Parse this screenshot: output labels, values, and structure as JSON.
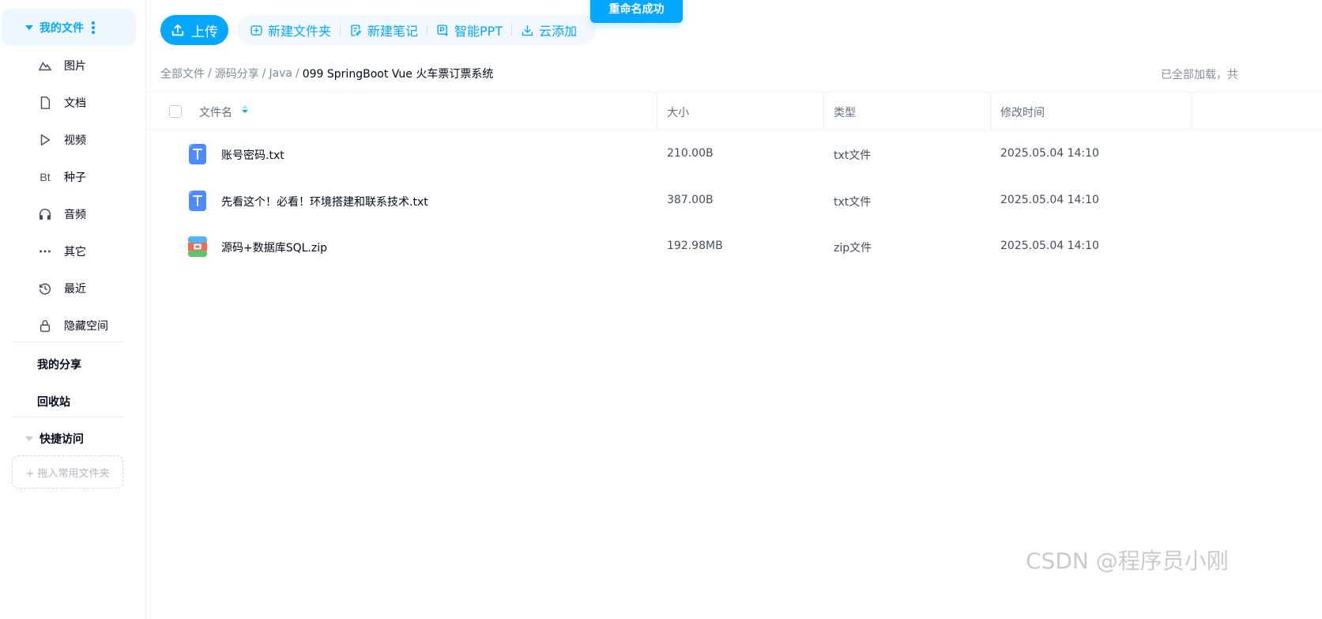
{
  "sidebar": {
    "header_label": "我的文件",
    "items": [
      {
        "label": "图片",
        "icon": "image-icon"
      },
      {
        "label": "文档",
        "icon": "document-icon"
      },
      {
        "label": "视频",
        "icon": "video-icon"
      },
      {
        "label": "种子",
        "icon": "torrent-icon",
        "glyph": "Bt"
      },
      {
        "label": "音频",
        "icon": "headphones-icon"
      },
      {
        "label": "其它",
        "icon": "more-horizontal-icon"
      },
      {
        "label": "最近",
        "icon": "history-icon"
      },
      {
        "label": "隐藏空间",
        "icon": "lock-icon"
      }
    ],
    "my_share": "我的分享",
    "recycle_bin": "回收站",
    "quick_access": "快捷访问",
    "drop_hint": "+ 拖入常用文件夹"
  },
  "toolbar": {
    "upload": "上传",
    "new_folder": "新建文件夹",
    "new_note": "新建笔记",
    "smart_ppt": "智能PPT",
    "cloud_add": "云添加"
  },
  "toast": "重命名成功",
  "breadcrumb": {
    "items": [
      "全部文件",
      "源码分享",
      "Java"
    ],
    "separator": "/",
    "current": "099 SpringBoot Vue 火车票订票系统"
  },
  "load_status": "已全部加载，共",
  "table": {
    "headers": {
      "name": "文件名",
      "size": "大小",
      "type": "类型",
      "modified": "修改时间"
    },
    "rows": [
      {
        "name": "账号密码.txt",
        "size": "210.00B",
        "type": "txt文件",
        "modified": "2025.05.04 14:10",
        "icon": "txt-file-icon"
      },
      {
        "name": "先看这个！必看！环境搭建和联系技术.txt",
        "size": "387.00B",
        "type": "txt文件",
        "modified": "2025.05.04 14:10",
        "icon": "txt-file-icon"
      },
      {
        "name": "源码+数据库SQL.zip",
        "size": "192.98MB",
        "type": "zip文件",
        "modified": "2025.05.04 14:10",
        "icon": "zip-file-icon"
      }
    ]
  },
  "watermark": "CSDN @程序员小刚",
  "colors": {
    "accent": "#06a7ff",
    "text": "#03081a",
    "muted": "#818999"
  }
}
